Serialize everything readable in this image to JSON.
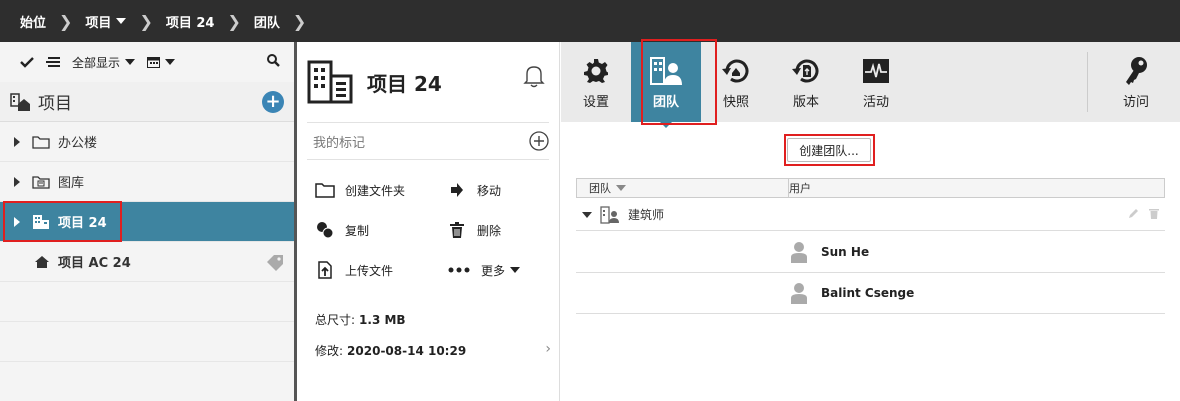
{
  "breadcrumb": [
    {
      "label": "始位"
    },
    {
      "label": "项目",
      "dropdown": true
    },
    {
      "label": "项目 24"
    },
    {
      "label": "团队"
    }
  ],
  "left": {
    "toolbar": {
      "show_all": "全部显示"
    },
    "tree_title": "项目",
    "items": [
      {
        "label": "办公楼",
        "icon": "folder-icon"
      },
      {
        "label": "图库",
        "icon": "library-icon"
      },
      {
        "label": "项目 24",
        "icon": "building-icon",
        "selected": true
      },
      {
        "label": "项目 AC 24",
        "icon": "house-icon"
      }
    ]
  },
  "middle": {
    "title": "项目 24",
    "my_marks": "我的标记",
    "actions": [
      {
        "label": "创建文件夹",
        "icon": "folder-icon"
      },
      {
        "label": "移动",
        "icon": "arrow-right-icon"
      },
      {
        "label": "复制",
        "icon": "copy-icon"
      },
      {
        "label": "删除",
        "icon": "trash-icon"
      },
      {
        "label": "上传文件",
        "icon": "upload-icon"
      },
      {
        "label": "更多",
        "icon": "more-icon"
      }
    ],
    "size_label": "总尺寸:",
    "size_value": "1.3 MB",
    "modified_label": "修改:",
    "modified_value": "2020-08-14 10:29"
  },
  "ribbon": [
    {
      "label": "设置",
      "icon": "gear-icon"
    },
    {
      "label": "团队",
      "icon": "team-icon",
      "active": true
    },
    {
      "label": "快照",
      "icon": "snapshot-icon"
    },
    {
      "label": "版本",
      "icon": "version-icon"
    },
    {
      "label": "活动",
      "icon": "activity-icon"
    }
  ],
  "access_label": "访问",
  "create_team_label": "创建团队...",
  "table": {
    "col_team": "团队",
    "col_users": "用户",
    "group": "建筑师",
    "users": [
      "Sun He",
      "Balint Csenge"
    ]
  },
  "colors": {
    "accent": "#3e84a0",
    "highlight": "#e01f1f",
    "topbar": "#2e2e2e"
  }
}
